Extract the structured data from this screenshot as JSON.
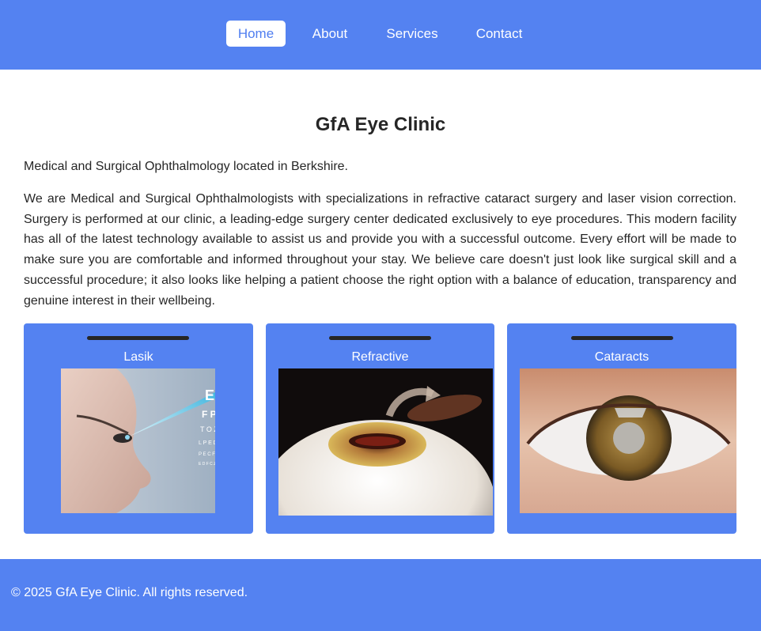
{
  "nav": {
    "items": [
      {
        "label": "Home",
        "active": true
      },
      {
        "label": "About",
        "active": false
      },
      {
        "label": "Services",
        "active": false
      },
      {
        "label": "Contact",
        "active": false
      }
    ]
  },
  "main": {
    "title": "GfA Eye Clinic",
    "intro": "Medical and Surgical Ophthalmology located in Berkshire.",
    "description": "We are Medical and Surgical Ophthalmologists with specializations in refractive cataract surgery and laser vision correction. Surgery is performed at our clinic, a leading-edge surgery center dedicated exclusively to eye procedures. This modern facility has all of the latest technology available to assist us and provide you with a successful outcome. Every effort will be made to make sure you are comfortable and informed throughout your stay. We believe care doesn't just look like surgical skill and a successful procedure; it also looks like helping a patient choose the right option with a balance of education, transparency and genuine interest in their wellbeing."
  },
  "services": [
    {
      "title": "Lasik",
      "image": "lasik-eye-laser-photo"
    },
    {
      "title": "Refractive",
      "image": "lens-implant-illustration"
    },
    {
      "title": "Cataracts",
      "image": "cataract-eye-closeup-photo"
    }
  ],
  "footer": {
    "copyright": "© 2025 GfA Eye Clinic. All rights reserved."
  },
  "colors": {
    "primary": "#5482f1",
    "text": "#262626",
    "active_link_text": "#4f7ef0",
    "white": "#ffffff"
  }
}
